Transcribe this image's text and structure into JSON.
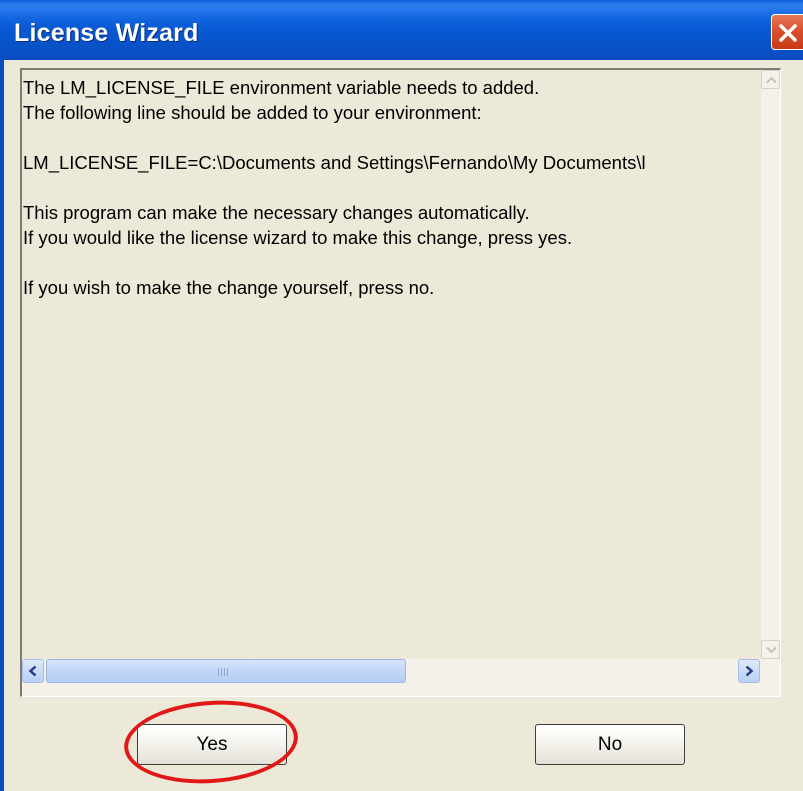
{
  "dialog": {
    "title": "License Wizard",
    "close_icon": "close-icon",
    "message_lines": [
      "The LM_LICENSE_FILE environment variable needs to added.",
      "The following line should be added to your environment:",
      "",
      "LM_LICENSE_FILE=C:\\Documents and Settings\\Fernando\\My Documents\\l",
      "",
      "This program can make the necessary changes automatically.",
      "If you would like the license wizard to make this change, press yes.",
      "",
      "If you wish to make the change yourself, press no."
    ],
    "buttons": {
      "yes_label": "Yes",
      "no_label": "No"
    },
    "annotation_color": "#e01818",
    "scrollbar_grip_text": "IIII"
  }
}
